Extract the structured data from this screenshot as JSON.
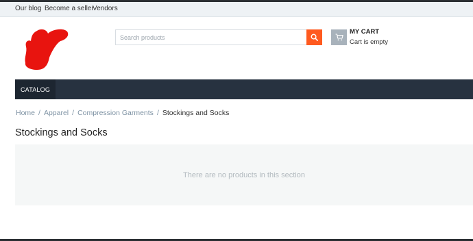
{
  "top_links": [
    "Our blog",
    "Become a seller",
    "Vendors"
  ],
  "search": {
    "placeholder": "Search products"
  },
  "cart": {
    "title": "MY CART",
    "status": "Cart is empty"
  },
  "nav": {
    "catalog_label": "CATALOG"
  },
  "breadcrumb": {
    "items": [
      "Home",
      "Apparel",
      "Compression Garments"
    ],
    "current": "Stockings and Socks",
    "separator": "/"
  },
  "page": {
    "title": "Stockings and Socks",
    "empty_message": "There are no products in this section"
  },
  "colors": {
    "search_button": "#ff5a1f",
    "nav_bar": "#273240",
    "nav_active": "#1d2631",
    "logo_scribble": "#e8140f"
  },
  "icons": [
    "search-icon",
    "cart-icon"
  ]
}
